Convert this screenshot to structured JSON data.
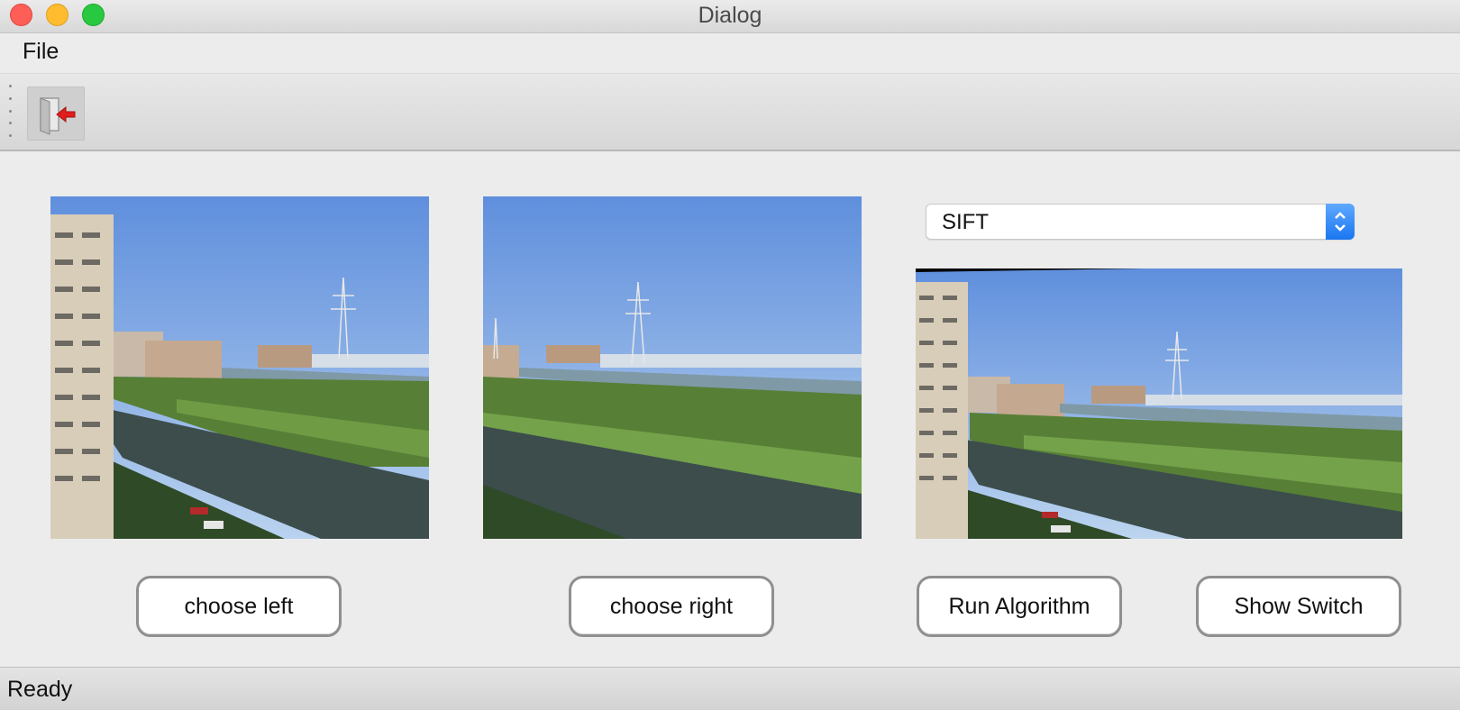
{
  "window": {
    "title": "Dialog"
  },
  "menubar": {
    "items": [
      {
        "label": "File"
      }
    ]
  },
  "toolbar": {
    "exit_icon": "exit-door-icon"
  },
  "algorithm_select": {
    "selected": "SIFT"
  },
  "images": {
    "left": "left-source-photo",
    "right": "right-source-photo",
    "result": "stitched-result-photo"
  },
  "buttons": {
    "choose_left": "choose left",
    "choose_right": "choose right",
    "run_algorithm": "Run Algorithm",
    "show_switch": "Show Switch"
  },
  "statusbar": {
    "text": "Ready"
  },
  "colors": {
    "sky": "#6f9ee4",
    "water": "#3b4a48",
    "grass": "#5b8a3a",
    "accent": "#1a76f1"
  }
}
